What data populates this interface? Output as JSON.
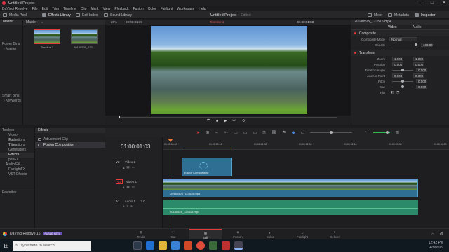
{
  "window": {
    "title": "Untitled Project",
    "minimize": "–",
    "maximize": "□",
    "close": "✕"
  },
  "menu": [
    "DaVinci Resolve",
    "File",
    "Edit",
    "Trim",
    "Timeline",
    "Clip",
    "Mark",
    "View",
    "Playback",
    "Fusion",
    "Color",
    "Fairlight",
    "Workspace",
    "Help"
  ],
  "toolbar": {
    "media_pool": "Media Pool",
    "effects_library": "Effects Library",
    "edit_index": "Edit Index",
    "sound_library": "Sound Library",
    "project_title": "Untitled Project",
    "project_status": "Edited",
    "mixer": "Mixer",
    "metadata": "Metadata",
    "inspector": "Inspector"
  },
  "viewer": {
    "zoom": "25%",
    "timecode_left": "00:00:31:19",
    "timeline_name": "Timeline 1",
    "timecode_right": "01:00:01:03"
  },
  "media_pool": {
    "bin": "Master",
    "clips": [
      {
        "label": "Timeline 1"
      },
      {
        "label": "20180525_123..."
      }
    ]
  },
  "sidebar": {
    "master": "Master",
    "power_bins": "Power Bins",
    "power_master": "Master",
    "smart_bins": "Smart Bins",
    "keywords": "Keywords"
  },
  "effects": {
    "header": "Effects",
    "tree": [
      "Toolbox",
      "Video Transitions",
      "Audio Transitions",
      "Titles",
      "Generators",
      "Effects",
      "OpenFX",
      "Audio FX",
      "FairlightFX",
      "VST Effects"
    ],
    "list": [
      "Adjustment Clip",
      "Fusion Composition"
    ],
    "favorites": "Favorites"
  },
  "inspector": {
    "clip_name": "20180525_123515.mp4",
    "tabs": [
      "Video",
      "Audio"
    ],
    "composite": "Composite",
    "composite_mode_label": "Composite Mode",
    "composite_mode": "Normal",
    "opacity_label": "Opacity",
    "opacity": "100.00",
    "transform": "Transform",
    "zoom_label": "Zoom",
    "zoom_x": "1.000",
    "zoom_y": "1.000",
    "position_label": "Position",
    "pos_x": "0.000",
    "pos_y": "0.000",
    "rotation_label": "Rotation Angle",
    "rotation": "0.000",
    "anchor_label": "Anchor Point",
    "anchor_x": "0.000",
    "anchor_y": "0.000",
    "pitch_label": "Pitch",
    "pitch": "0.000",
    "yaw_label": "Yaw",
    "yaw": "0.000",
    "flip_label": "Flip"
  },
  "timeline": {
    "timecode": "01:00:01:03",
    "ruler": [
      "01:00:00:00",
      "01:00:00:16",
      "01:00:01:08",
      "01:00:02:00",
      "01:00:02:16",
      "01:00:03:08",
      "01:00:04:00"
    ],
    "tracks": {
      "v2": {
        "id": "V2",
        "name": "Video 2"
      },
      "v1": {
        "id": "V1",
        "name": "Video 1"
      },
      "a1": {
        "id": "A1",
        "name": "Audio 1",
        "level": "2.0"
      }
    },
    "fusion_clip": "Fusion Composition",
    "video_clip": "20180525_123515.mp4",
    "audio_clip": "20180525_123515.mp4"
  },
  "pages": [
    "Media",
    "Cut",
    "Edit",
    "Fusion",
    "Color",
    "Fairlight",
    "Deliver"
  ],
  "app": {
    "name": "DaVinci Resolve 16",
    "badge": "PUBLIC BETA"
  },
  "taskbar": {
    "search": "Type here to search",
    "time": "12:42 PM",
    "date": "4/9/2019"
  },
  "colors": {
    "accent": "#e33a3a",
    "clip_blue": "#2f6f93",
    "audio_green": "#2a8a6a",
    "taskbar": "#101820"
  }
}
